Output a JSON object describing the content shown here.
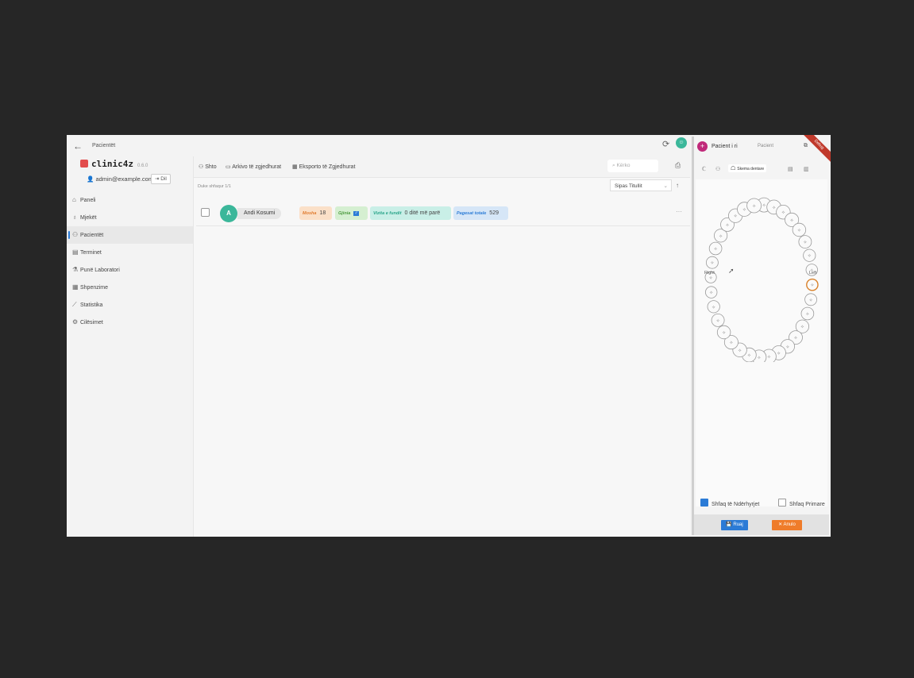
{
  "breadcrumb": "Pacientët",
  "app": {
    "name": "clinic4z",
    "version": "0.6.0"
  },
  "user": {
    "email": "admin@example.com",
    "logout_label": "Dil"
  },
  "nav": [
    {
      "icon": "home-icon",
      "label": "Paneli",
      "active": false
    },
    {
      "icon": "stethoscope-icon",
      "label": "Mjekët",
      "active": false
    },
    {
      "icon": "patients-icon",
      "label": "Pacientët",
      "active": true
    },
    {
      "icon": "calendar-icon",
      "label": "Terminet",
      "active": false
    },
    {
      "icon": "lab-icon",
      "label": "Punë Laboratori",
      "active": false
    },
    {
      "icon": "expense-icon",
      "label": "Shpenzime",
      "active": false
    },
    {
      "icon": "chart-icon",
      "label": "Statistika",
      "active": false
    },
    {
      "icon": "settings-icon",
      "label": "Cilësimet",
      "active": false
    }
  ],
  "toolbar": {
    "add_label": "Shto",
    "archive_label": "Arkivo të zgjedhurat",
    "export_label": "Eksporto të Zgjedhurat",
    "search_placeholder": "Kërko"
  },
  "list": {
    "result_count": "Duke shfaqur 1/1",
    "sort_label": "Sipas Titullit",
    "rows": [
      {
        "initial": "A",
        "name": "Andi Kosumi",
        "age_label": "Mosha",
        "age": "18",
        "gender_label": "Gjinia",
        "gender": "♂",
        "visit_label": "Vizita e fundit",
        "visit": "0 ditë më parë",
        "payments_label": "Pagesat totale",
        "payments": "529"
      }
    ]
  },
  "panel": {
    "title": "Pacient i ri",
    "subtitle": "Pacient",
    "ribbon": "Debug",
    "active_tab": "Skema dentare",
    "labels": {
      "right": "Right",
      "left": "Left"
    },
    "show_treatments": "Shfaq të Ndërhyrjet",
    "show_primary": "Shfaq Primare",
    "save_label": "Ruaj",
    "cancel_label": "Anulo"
  },
  "colors": {
    "accent": "#2b7bd6",
    "avatar": "#3bb79a",
    "age_badge": "#fbe0c8",
    "gender_badge": "#d5efd1",
    "visit_badge": "#c9efe7",
    "payments_badge": "#d6e6f7",
    "cancel": "#ef7c2a"
  }
}
